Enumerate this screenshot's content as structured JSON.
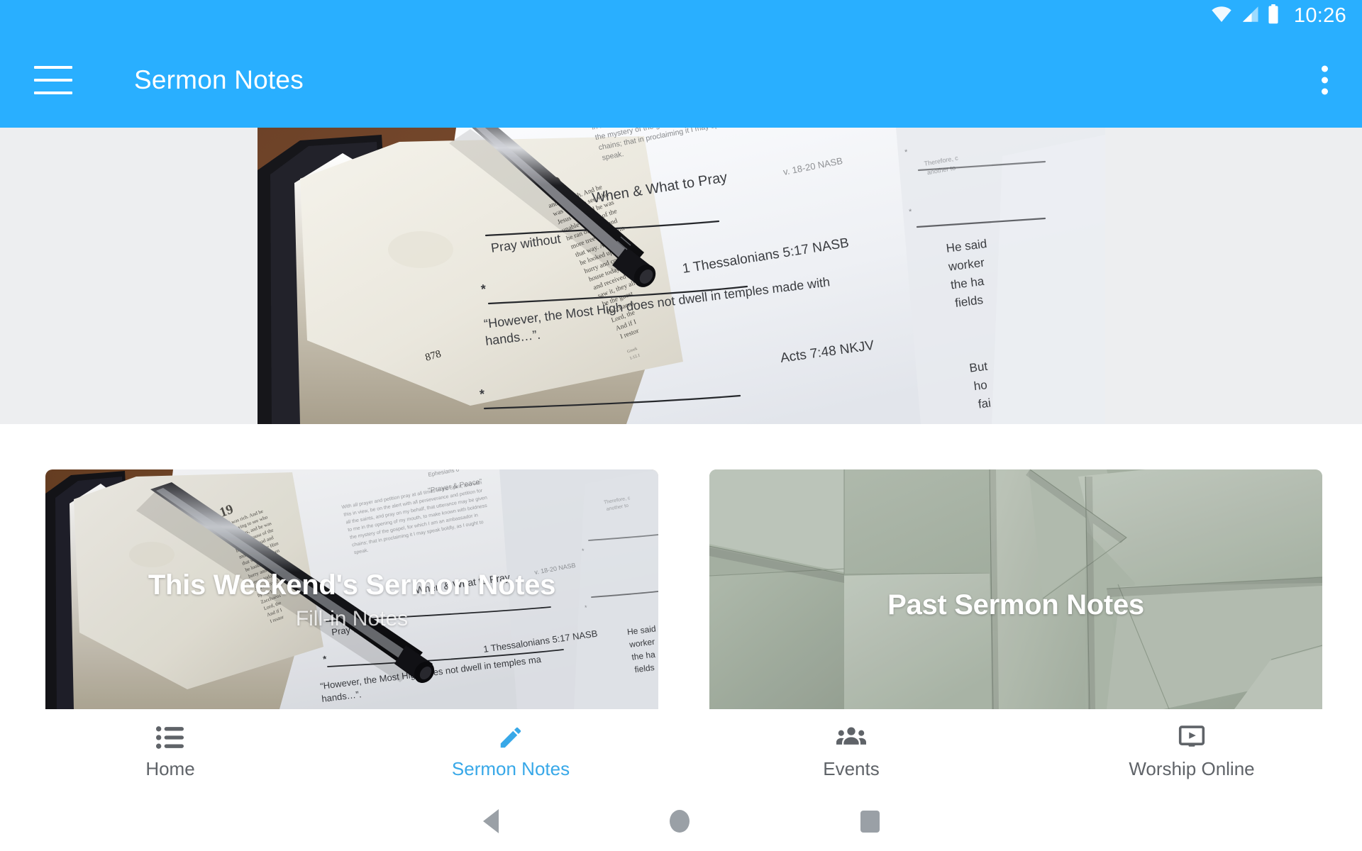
{
  "status_bar": {
    "clock": "10:26",
    "icons": [
      "wifi-icon",
      "cell-signal-icon",
      "battery-icon"
    ]
  },
  "app_bar": {
    "title": "Sermon Notes",
    "menu_icon": "hamburger-menu-icon",
    "overflow_icon": "overflow-menu-icon",
    "background_color": "#29AFFF"
  },
  "hero": {
    "alt": "Open Bible with black pen lying on printed fill-in sermon notes",
    "background_color": "#EDEEF0",
    "visible_text": {
      "page_number": "878",
      "heading": "When & What to Pray",
      "line_1": "Pray without",
      "ref_1": "1 Thessalonians 5:17 NASB",
      "quote": "“However, the Most High does not dwell in temples made with hands…”.",
      "ref_2": "Acts 7:48 NKJV",
      "ref_3": "v. 18-20 NASB",
      "side_fragment": "He said... workers... the ha... fields",
      "side_fragment_2": "But... ho... fai"
    }
  },
  "cards": [
    {
      "title": "This Weekend's Sermon Notes",
      "subtitle": "Fill-in Notes",
      "image_alt": "Open Bible with pen on sermon fill-in notes"
    },
    {
      "title": "Past Sermon Notes",
      "subtitle": "",
      "image_alt": "Overlapping sage green paper sheets"
    }
  ],
  "bottom_nav": {
    "active_color": "#38A8E8",
    "inactive_color": "#5f6368",
    "tabs": [
      {
        "label": "Home",
        "icon": "list-icon",
        "active": false
      },
      {
        "label": "Sermon Notes",
        "icon": "pencil-icon",
        "active": true
      },
      {
        "label": "Events",
        "icon": "people-group-icon",
        "active": false
      },
      {
        "label": "Worship Online",
        "icon": "monitor-play-icon",
        "active": false
      }
    ]
  },
  "system_nav": {
    "back": "back-triangle-icon",
    "home": "home-circle-icon",
    "recents": "recents-square-icon"
  }
}
